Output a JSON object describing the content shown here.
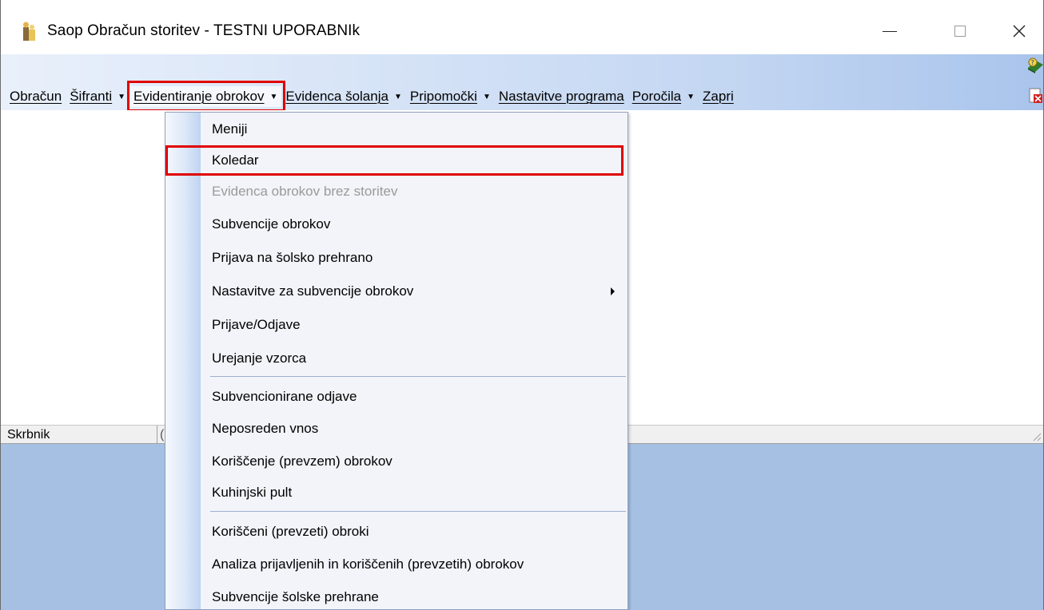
{
  "window": {
    "title": "Saop Obračun storitev - TESTNI UPORABNIk",
    "icon": "app-people-icon",
    "controls": [
      "minimize-icon",
      "maximize-icon",
      "close-icon"
    ]
  },
  "menubar": {
    "items": [
      {
        "label": "Obračun",
        "has_caret": false
      },
      {
        "label": "Šifranti",
        "has_caret": true
      },
      {
        "label": "Evidentiranje obrokov",
        "has_caret": true,
        "active": true
      },
      {
        "label": "Evidenca šolanja",
        "has_caret": true
      },
      {
        "label": "Pripomočki",
        "has_caret": true
      },
      {
        "label": "Nastavitve programa",
        "has_caret": false
      },
      {
        "label": "Poročila",
        "has_caret": true
      },
      {
        "label": "Zapri",
        "has_caret": false
      }
    ],
    "caret": "▼"
  },
  "dropdown": {
    "items": [
      {
        "label": "Meniji"
      },
      {
        "label": "Koledar",
        "highlighted": true
      },
      {
        "label": "Evidenca obrokov brez storitev",
        "disabled": true
      },
      {
        "label": "Subvencije obrokov"
      },
      {
        "label": "Prijava na šolsko prehrano"
      },
      {
        "label": "Nastavitve za subvencije obrokov",
        "submenu": true
      },
      {
        "label": "Prijave/Odjave"
      },
      {
        "label": "Urejanje vzorca"
      },
      {
        "label": "Subvencionirane odjave"
      },
      {
        "label": "Neposreden vnos"
      },
      {
        "label": "Koriščenje (prevzem) obrokov"
      },
      {
        "label": "Kuhinjski pult"
      },
      {
        "label": "Koriščeni (prevzeti) obroki"
      },
      {
        "label": "Analiza prijavljenih in koriščenih (prevzetih) obrokov"
      },
      {
        "label": "Subvencije šolske prehrane"
      }
    ]
  },
  "statusbar": {
    "left": "Skrbnik",
    "second": "("
  },
  "toolbar": {
    "icons": [
      "help-book-icon",
      "exit-document-icon"
    ]
  },
  "colors": {
    "highlight_border": "#e00000",
    "mdi_background": "#a6c0e4",
    "menu_gradient_end": "#a9c4ec"
  }
}
